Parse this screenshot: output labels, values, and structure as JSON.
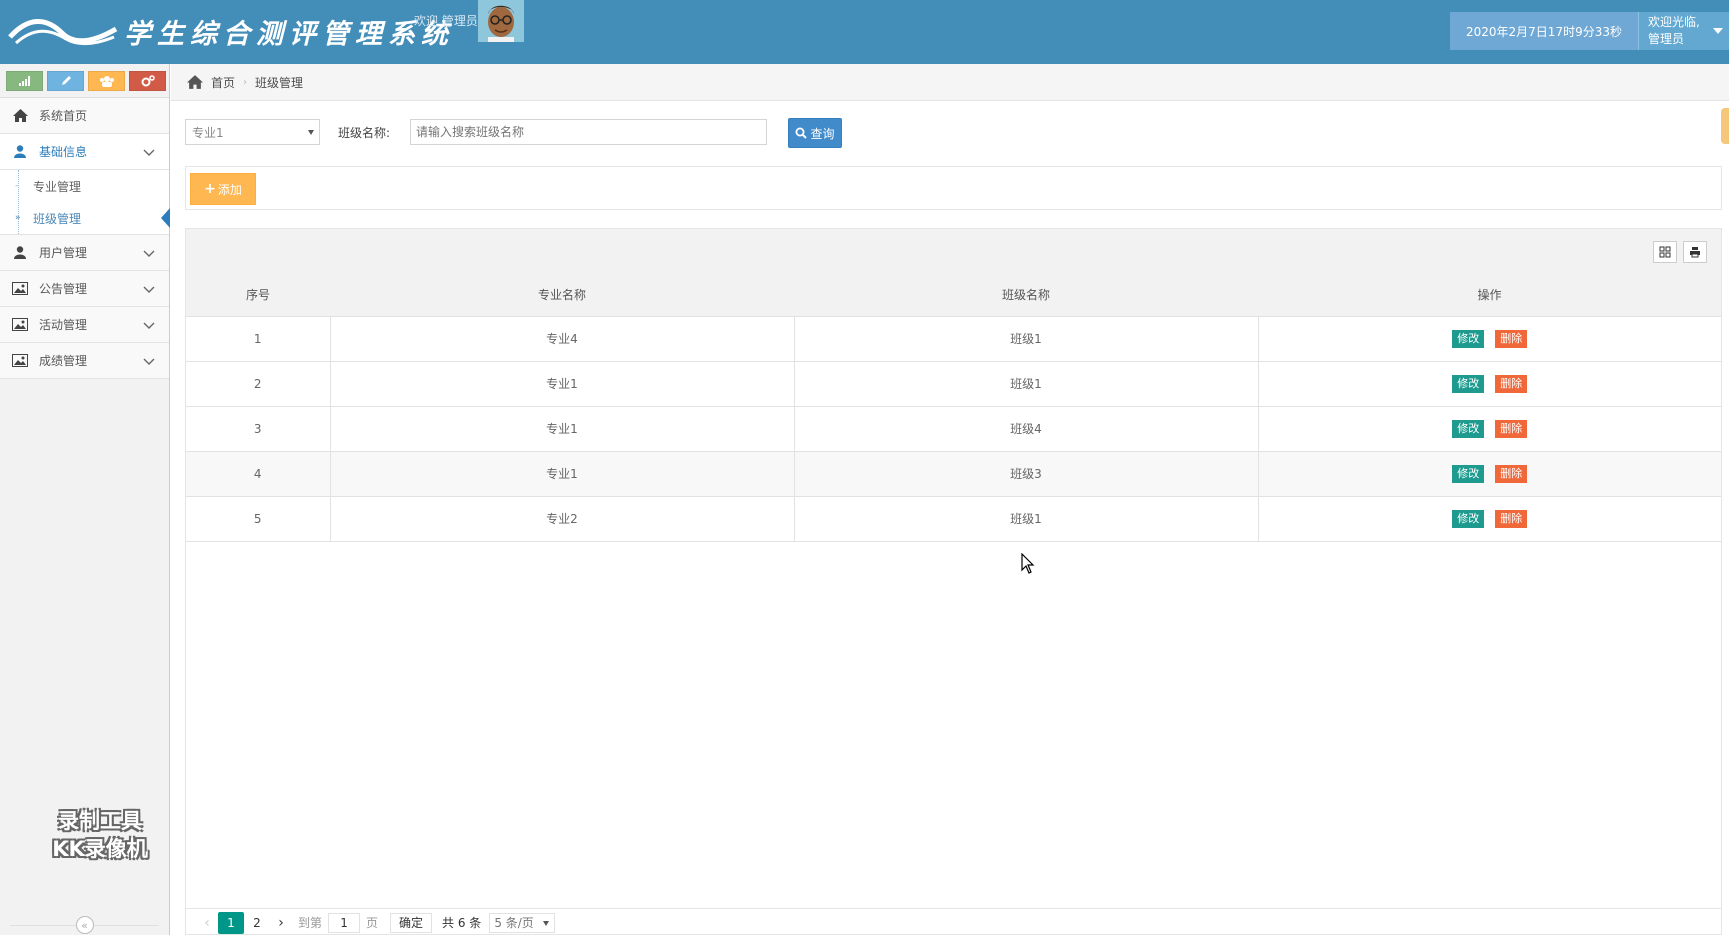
{
  "header": {
    "title": "学生综合测评管理系统",
    "welcome_small": "欢迎 管理员",
    "datetime": "2020年2月7日17时9分33秒",
    "user_line1": "欢迎光临,",
    "user_line2": "管理员"
  },
  "shortcuts": [
    {
      "icon": "signal-icon",
      "color": "#87b87f"
    },
    {
      "icon": "pencil-icon",
      "color": "#6fb3e0"
    },
    {
      "icon": "group-icon",
      "color": "#ffb752"
    },
    {
      "icon": "cogs-icon",
      "color": "#d15b47"
    }
  ],
  "sidebar": {
    "items": [
      {
        "label": "系统首页",
        "icon": "home-icon"
      },
      {
        "label": "基础信息",
        "icon": "user-icon",
        "children": [
          "专业管理",
          "班级管理"
        ]
      },
      {
        "label": "用户管理",
        "icon": "user-icon"
      },
      {
        "label": "公告管理",
        "icon": "picture-icon"
      },
      {
        "label": "活动管理",
        "icon": "picture-icon"
      },
      {
        "label": "成绩管理",
        "icon": "picture-icon"
      }
    ],
    "watermark_line1": "录制工具",
    "watermark_line2": "KK录像机"
  },
  "breadcrumb": {
    "home": "首页",
    "current": "班级管理"
  },
  "search": {
    "select_value": "专业1",
    "label": "班级名称:",
    "placeholder": "请输入搜索班级名称",
    "query_label": "查询"
  },
  "toolbar": {
    "add_label": "添加"
  },
  "table": {
    "columns": [
      "序号",
      "专业名称",
      "班级名称",
      "操作"
    ],
    "rows": [
      {
        "no": "1",
        "major": "专业4",
        "class": "班级1"
      },
      {
        "no": "2",
        "major": "专业1",
        "class": "班级1"
      },
      {
        "no": "3",
        "major": "专业1",
        "class": "班级4"
      },
      {
        "no": "4",
        "major": "专业1",
        "class": "班级3"
      },
      {
        "no": "5",
        "major": "专业2",
        "class": "班级1"
      }
    ],
    "edit_label": "修改",
    "delete_label": "删除"
  },
  "pager": {
    "pages": [
      "1",
      "2"
    ],
    "goto_label": "到第",
    "goto_value": "1",
    "page_unit": "页",
    "confirm_label": "确定",
    "total": "共 6 条",
    "page_size": "5 条/页"
  },
  "colors": {
    "header_bg": "#438eb9",
    "active_blue": "#2b7dbc",
    "pager_active": "#009688",
    "edit_btn": "#1e9b8e",
    "delete_btn": "#f0683a",
    "add_btn": "#ffb752"
  }
}
